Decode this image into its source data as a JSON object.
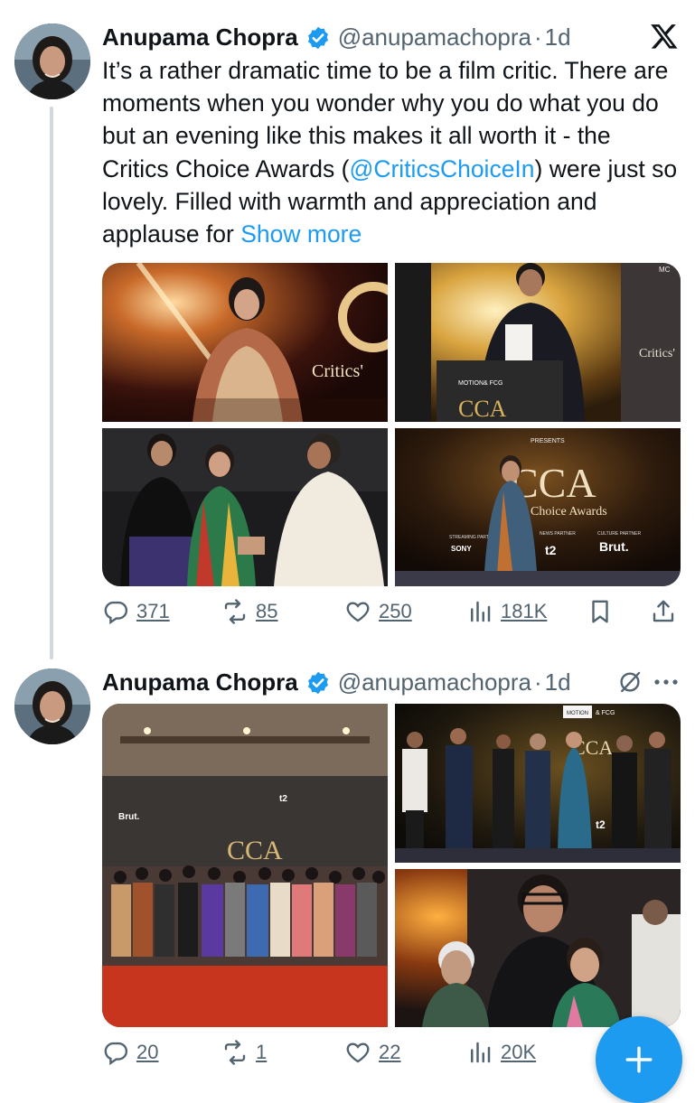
{
  "tweets": [
    {
      "name": "Anupama Chopra",
      "handle": "@anupamachopra",
      "sep": "·",
      "time": "1d",
      "text_before": "It’s a rather dramatic time to be a film critic. There are moments when you wonder why you do what you do but an evening like this makes it all worth it - the Critics Choice Awards (",
      "mention": "@CriticsChoiceIn",
      "text_after": ") were just so lovely. Filled with warmth and appreciation and applause for ",
      "show_more": "Show more",
      "stats": {
        "replies": "371",
        "reposts": "85",
        "likes": "250",
        "views": "181K"
      }
    },
    {
      "name": "Anupama Chopra",
      "handle": "@anupamachopra",
      "sep": "·",
      "time": "1d",
      "stats": {
        "replies": "20",
        "reposts": "1",
        "likes": "22",
        "views": "20K"
      }
    }
  ],
  "photo_text": {
    "critics": "Critics'",
    "critics2": "Critics'",
    "cca": "CCA",
    "choice_awards": "Choice Awards",
    "brut": "Brut.",
    "t2": "t2",
    "sony": "SONY",
    "motion": "MOTION",
    "fcg": "& FCG",
    "presents": "PRESENTS",
    "mc": "MC",
    "streaming_partner": "STREAMING PARTNER",
    "news_partner": "NEWS PARTNER",
    "culture_partner": "CULTURE PARTNER"
  },
  "icons": [
    "x-logo-icon",
    "verified-badge-icon",
    "reply-icon",
    "repost-icon",
    "like-icon",
    "views-icon",
    "bookmark-icon",
    "share-icon",
    "grok-icon",
    "more-icon",
    "compose-plus-icon"
  ],
  "colors": {
    "accent": "#1d9bf0",
    "muted": "#536471",
    "text": "#0f1419",
    "thread_line": "#cfd9de"
  }
}
